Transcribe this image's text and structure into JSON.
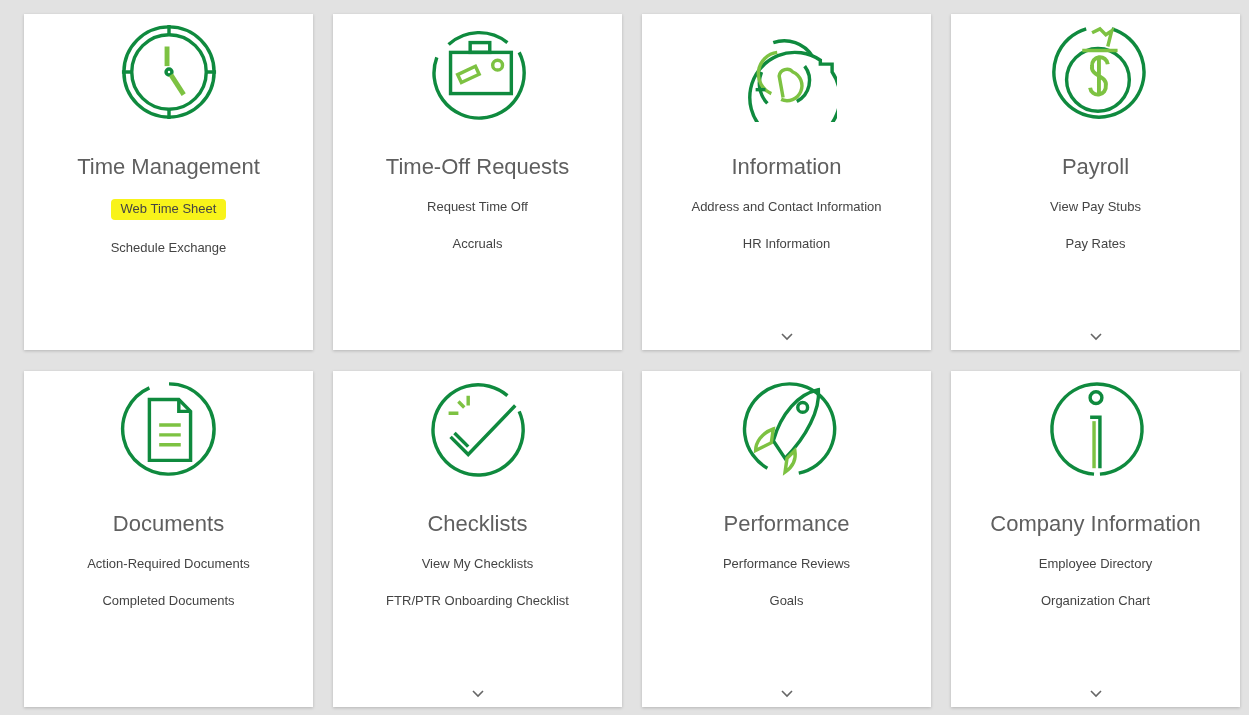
{
  "cards": [
    {
      "title": "Time Management",
      "links": [
        {
          "label": "Web Time Sheet",
          "highlighted": true
        },
        {
          "label": "Schedule Exchange",
          "highlighted": false
        }
      ],
      "expandable": false
    },
    {
      "title": "Time-Off Requests",
      "links": [
        {
          "label": "Request Time Off",
          "highlighted": false
        },
        {
          "label": "Accruals",
          "highlighted": false
        }
      ],
      "expandable": false
    },
    {
      "title": "Information",
      "links": [
        {
          "label": "Address and Contact Information",
          "highlighted": false
        },
        {
          "label": "HR Information",
          "highlighted": false
        }
      ],
      "expandable": true
    },
    {
      "title": "Payroll",
      "links": [
        {
          "label": "View Pay Stubs",
          "highlighted": false
        },
        {
          "label": "Pay Rates",
          "highlighted": false
        }
      ],
      "expandable": true
    },
    {
      "title": "Documents",
      "links": [
        {
          "label": "Action-Required Documents",
          "highlighted": false
        },
        {
          "label": "Completed Documents",
          "highlighted": false
        }
      ],
      "expandable": false
    },
    {
      "title": "Checklists",
      "links": [
        {
          "label": "View My Checklists",
          "highlighted": false
        },
        {
          "label": "FTR/PTR Onboarding Checklist",
          "highlighted": false
        }
      ],
      "expandable": true
    },
    {
      "title": "Performance",
      "links": [
        {
          "label": "Performance Reviews",
          "highlighted": false
        },
        {
          "label": "Goals",
          "highlighted": false
        }
      ],
      "expandable": true
    },
    {
      "title": "Company Information",
      "links": [
        {
          "label": "Employee Directory",
          "highlighted": false
        },
        {
          "label": "Organization Chart",
          "highlighted": false
        }
      ],
      "expandable": true
    }
  ]
}
